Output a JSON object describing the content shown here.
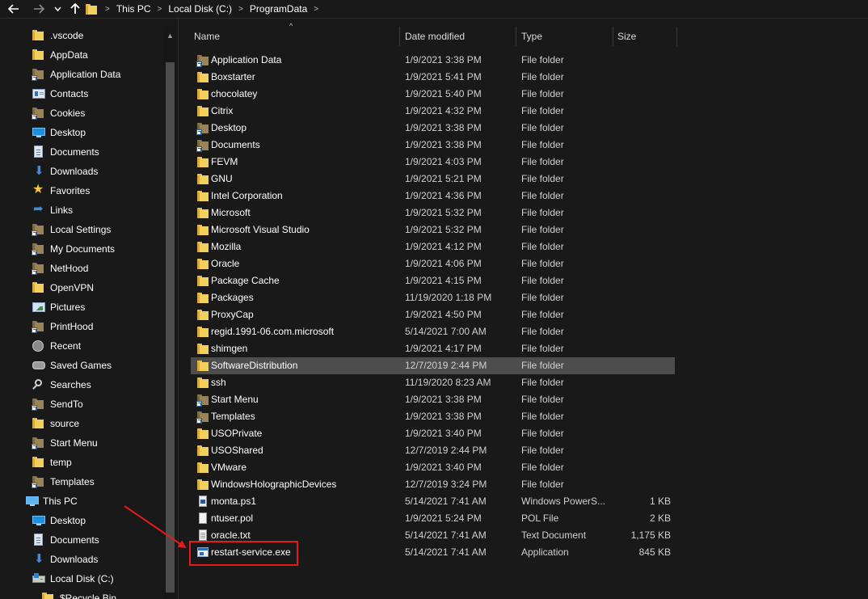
{
  "address_bar": {
    "crumbs": [
      "This PC",
      "Local Disk (C:)",
      "ProgramData"
    ],
    "separator": ">"
  },
  "columns": {
    "name": "Name",
    "date": "Date modified",
    "type": "Type",
    "size": "Size"
  },
  "sidebar": {
    "items": [
      {
        "label": ".vscode",
        "icon": "folder-icon"
      },
      {
        "label": "AppData",
        "icon": "folder-icon"
      },
      {
        "label": "Application Data",
        "icon": "folder-shortcut-icon"
      },
      {
        "label": "Contacts",
        "icon": "contacts-icon"
      },
      {
        "label": "Cookies",
        "icon": "folder-shortcut-icon"
      },
      {
        "label": "Desktop",
        "icon": "desktop-icon"
      },
      {
        "label": "Documents",
        "icon": "documents-icon"
      },
      {
        "label": "Downloads",
        "icon": "downloads-icon"
      },
      {
        "label": "Favorites",
        "icon": "star-icon"
      },
      {
        "label": "Links",
        "icon": "links-icon"
      },
      {
        "label": "Local Settings",
        "icon": "folder-shortcut-icon"
      },
      {
        "label": "My Documents",
        "icon": "folder-shortcut-icon"
      },
      {
        "label": "NetHood",
        "icon": "folder-shortcut-icon"
      },
      {
        "label": "OpenVPN",
        "icon": "folder-icon"
      },
      {
        "label": "Pictures",
        "icon": "pictures-icon"
      },
      {
        "label": "PrintHood",
        "icon": "folder-shortcut-icon"
      },
      {
        "label": "Recent",
        "icon": "recent-icon"
      },
      {
        "label": "Saved Games",
        "icon": "saved-games-icon"
      },
      {
        "label": "Searches",
        "icon": "search-icon"
      },
      {
        "label": "SendTo",
        "icon": "folder-shortcut-icon"
      },
      {
        "label": "source",
        "icon": "folder-icon"
      },
      {
        "label": "Start Menu",
        "icon": "folder-shortcut-icon"
      },
      {
        "label": "temp",
        "icon": "folder-icon"
      },
      {
        "label": "Templates",
        "icon": "folder-shortcut-icon"
      }
    ],
    "this_pc": {
      "label": "This PC",
      "icon": "this-pc-icon"
    },
    "this_pc_items": [
      {
        "label": "Desktop",
        "icon": "desktop-icon"
      },
      {
        "label": "Documents",
        "icon": "documents-icon"
      },
      {
        "label": "Downloads",
        "icon": "downloads-icon"
      },
      {
        "label": "Local Disk (C:)",
        "icon": "drive-icon"
      },
      {
        "label": "$Recycle.Bin",
        "icon": "folder-icon"
      }
    ]
  },
  "files": [
    {
      "name": "Application Data",
      "date": "1/9/2021 3:38 PM",
      "type": "File folder",
      "size": "",
      "icon": "folder-shortcut"
    },
    {
      "name": "Boxstarter",
      "date": "1/9/2021 5:41 PM",
      "type": "File folder",
      "size": "",
      "icon": "folder"
    },
    {
      "name": "chocolatey",
      "date": "1/9/2021 5:40 PM",
      "type": "File folder",
      "size": "",
      "icon": "folder"
    },
    {
      "name": "Citrix",
      "date": "1/9/2021 4:32 PM",
      "type": "File folder",
      "size": "",
      "icon": "folder"
    },
    {
      "name": "Desktop",
      "date": "1/9/2021 3:38 PM",
      "type": "File folder",
      "size": "",
      "icon": "folder-shortcut"
    },
    {
      "name": "Documents",
      "date": "1/9/2021 3:38 PM",
      "type": "File folder",
      "size": "",
      "icon": "folder-shortcut"
    },
    {
      "name": "FEVM",
      "date": "1/9/2021 4:03 PM",
      "type": "File folder",
      "size": "",
      "icon": "folder"
    },
    {
      "name": "GNU",
      "date": "1/9/2021 5:21 PM",
      "type": "File folder",
      "size": "",
      "icon": "folder"
    },
    {
      "name": "Intel Corporation",
      "date": "1/9/2021 4:36 PM",
      "type": "File folder",
      "size": "",
      "icon": "folder"
    },
    {
      "name": "Microsoft",
      "date": "1/9/2021 5:32 PM",
      "type": "File folder",
      "size": "",
      "icon": "folder"
    },
    {
      "name": "Microsoft Visual Studio",
      "date": "1/9/2021 5:32 PM",
      "type": "File folder",
      "size": "",
      "icon": "folder"
    },
    {
      "name": "Mozilla",
      "date": "1/9/2021 4:12 PM",
      "type": "File folder",
      "size": "",
      "icon": "folder"
    },
    {
      "name": "Oracle",
      "date": "1/9/2021 4:06 PM",
      "type": "File folder",
      "size": "",
      "icon": "folder"
    },
    {
      "name": "Package Cache",
      "date": "1/9/2021 4:15 PM",
      "type": "File folder",
      "size": "",
      "icon": "folder"
    },
    {
      "name": "Packages",
      "date": "11/19/2020 1:18 PM",
      "type": "File folder",
      "size": "",
      "icon": "folder"
    },
    {
      "name": "ProxyCap",
      "date": "1/9/2021 4:50 PM",
      "type": "File folder",
      "size": "",
      "icon": "folder"
    },
    {
      "name": "regid.1991-06.com.microsoft",
      "date": "5/14/2021 7:00 AM",
      "type": "File folder",
      "size": "",
      "icon": "folder"
    },
    {
      "name": "shimgen",
      "date": "1/9/2021 4:17 PM",
      "type": "File folder",
      "size": "",
      "icon": "folder"
    },
    {
      "name": "SoftwareDistribution",
      "date": "12/7/2019 2:44 PM",
      "type": "File folder",
      "size": "",
      "icon": "folder",
      "selected": true
    },
    {
      "name": "ssh",
      "date": "11/19/2020 8:23 AM",
      "type": "File folder",
      "size": "",
      "icon": "folder"
    },
    {
      "name": "Start Menu",
      "date": "1/9/2021 3:38 PM",
      "type": "File folder",
      "size": "",
      "icon": "folder-shortcut"
    },
    {
      "name": "Templates",
      "date": "1/9/2021 3:38 PM",
      "type": "File folder",
      "size": "",
      "icon": "folder-shortcut"
    },
    {
      "name": "USOPrivate",
      "date": "1/9/2021 3:40 PM",
      "type": "File folder",
      "size": "",
      "icon": "folder"
    },
    {
      "name": "USOShared",
      "date": "12/7/2019 2:44 PM",
      "type": "File folder",
      "size": "",
      "icon": "folder"
    },
    {
      "name": "VMware",
      "date": "1/9/2021 3:40 PM",
      "type": "File folder",
      "size": "",
      "icon": "folder"
    },
    {
      "name": "WindowsHolographicDevices",
      "date": "12/7/2019 3:24 PM",
      "type": "File folder",
      "size": "",
      "icon": "folder"
    },
    {
      "name": "monta.ps1",
      "date": "5/14/2021 7:41 AM",
      "type": "Windows PowerS...",
      "size": "1 KB",
      "icon": "ps1"
    },
    {
      "name": "ntuser.pol",
      "date": "1/9/2021 5:24 PM",
      "type": "POL File",
      "size": "2 KB",
      "icon": "file"
    },
    {
      "name": "oracle.txt",
      "date": "5/14/2021 7:41 AM",
      "type": "Text Document",
      "size": "1,175 KB",
      "icon": "text"
    },
    {
      "name": "restart-service.exe",
      "date": "5/14/2021 7:41 AM",
      "type": "Application",
      "size": "845 KB",
      "icon": "exe",
      "highlighted": true
    }
  ],
  "colors": {
    "background": "#191919",
    "selected_row": "#4d4d4d",
    "folder_yellow": "#f3cf5b",
    "annotation_red": "#e21b1b"
  }
}
